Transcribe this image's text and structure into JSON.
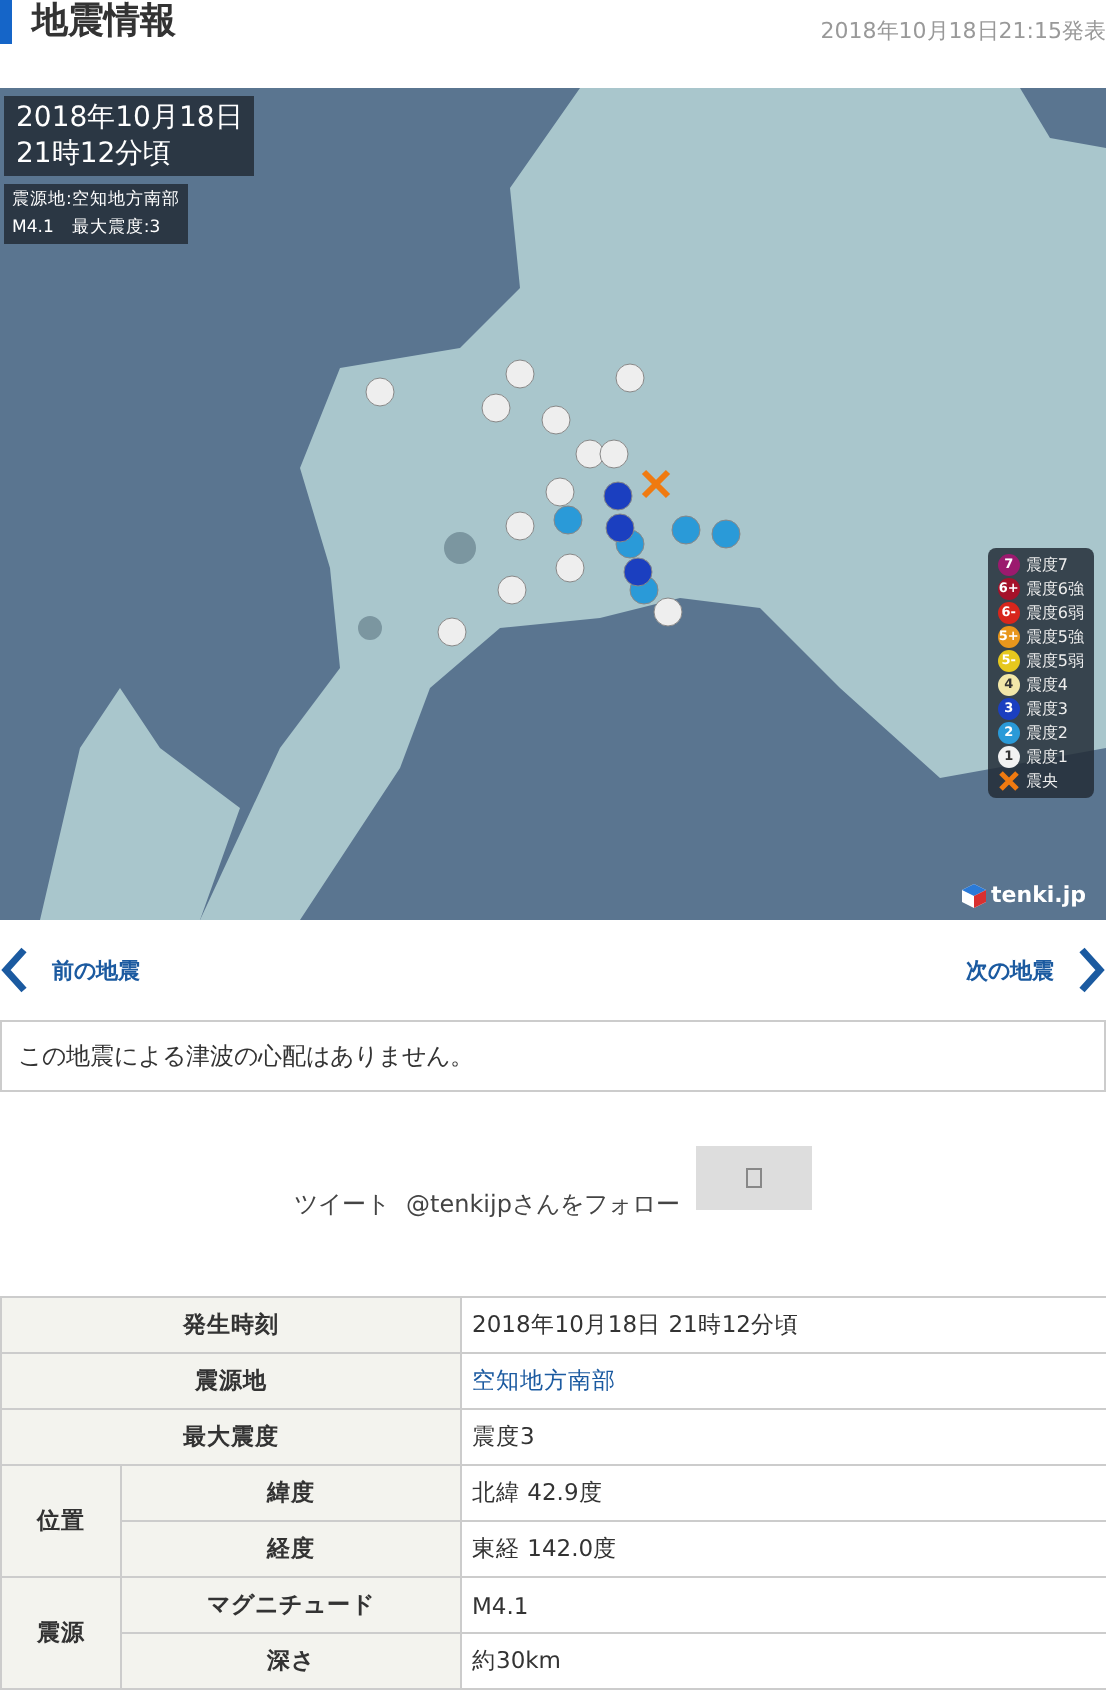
{
  "header": {
    "title": "地震情報",
    "published": "2018年10月18日21:15発表"
  },
  "map": {
    "kind": "picture",
    "datetime_lines": [
      "2018年10月18日",
      "21時12分頃"
    ],
    "info_lines": [
      "震源地:空知地方南部",
      "M4.1　最大震度:3"
    ],
    "legend": [
      {
        "kind": "intensity",
        "symbol": "7",
        "label": "震度7",
        "color": "#9b1a6e"
      },
      {
        "kind": "intensity",
        "symbol": "6+",
        "label": "震度6強",
        "color": "#a5122a"
      },
      {
        "kind": "intensity",
        "symbol": "6-",
        "label": "震度6弱",
        "color": "#d8261c"
      },
      {
        "kind": "intensity",
        "symbol": "5+",
        "label": "震度5強",
        "color": "#e8961c"
      },
      {
        "kind": "intensity",
        "symbol": "5-",
        "label": "震度5弱",
        "color": "#e6c81e"
      },
      {
        "kind": "intensity",
        "symbol": "4",
        "label": "震度4",
        "color": "#f2e7a8"
      },
      {
        "kind": "intensity",
        "symbol": "3",
        "label": "震度3",
        "color": "#1b3fc0"
      },
      {
        "kind": "intensity",
        "symbol": "2",
        "label": "震度2",
        "color": "#2a9ad8"
      },
      {
        "kind": "intensity",
        "symbol": "1",
        "label": "震度1",
        "color": "#f2f2f2"
      },
      {
        "kind": "epicenter",
        "label": "震央",
        "color": "#f07a10"
      }
    ],
    "brand": "tenki.jp"
  },
  "nav": {
    "previous": "前の地震",
    "next": "次の地震"
  },
  "notice": "この地震による津波の心配はありません。",
  "social": {
    "tweet": "ツイート",
    "follow": "@tenkijpさんをフォロー"
  },
  "table": [
    {
      "label": "発生時刻",
      "value": "2018年10月18日 21時12分頃",
      "link": false
    },
    {
      "label": "震源地",
      "value": "空知地方南部",
      "link": true
    },
    {
      "label": "最大震度",
      "value": "震度3",
      "link": false
    },
    {
      "group": "位置",
      "rows": [
        {
          "label": "緯度",
          "value": "北緯 42.9度",
          "link": false
        },
        {
          "label": "経度",
          "value": "東経 142.0度",
          "link": false
        }
      ]
    },
    {
      "group": "震源",
      "rows": [
        {
          "label": "マグニチュード",
          "value": "M4.1",
          "link": false
        },
        {
          "label": "深さ",
          "value": "約30km",
          "link": false
        }
      ]
    }
  ]
}
